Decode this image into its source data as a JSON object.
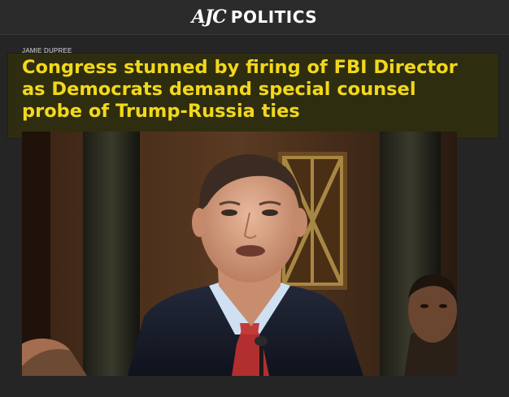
{
  "header": {
    "logo_mark": "AJC",
    "section": "POLITICS"
  },
  "article": {
    "byline": "JAMIE DUPREE",
    "headline": "Congress stunned by firing of FBI Director as Democrats demand special counsel probe of Trump-Russia ties"
  },
  "colors": {
    "background": "#252525",
    "headline_text": "#f2d81c",
    "headline_box": "#2f2d0f"
  }
}
